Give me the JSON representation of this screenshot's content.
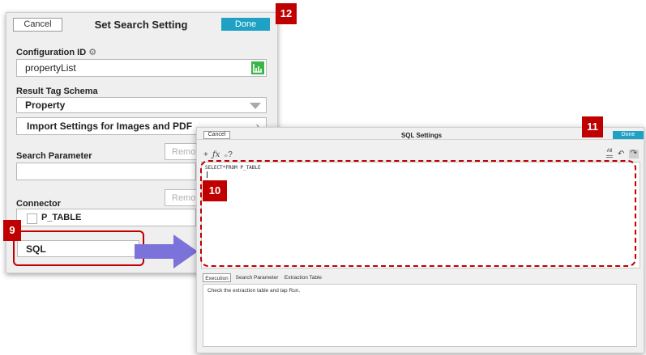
{
  "search_setting": {
    "cancel_label": "Cancel",
    "title": "Set Search Setting",
    "done_label": "Done",
    "configuration_id_label": "Configuration ID",
    "configuration_id_value": "propertyList",
    "result_tag_schema_label": "Result Tag Schema",
    "result_tag_schema_value": "Property",
    "import_settings_label": "Import Settings for Images and PDF",
    "search_parameter_label": "Search Parameter",
    "remove_label": "Remo",
    "connector_label": "Connector",
    "connector_item": "P_TABLE",
    "sql_label": "SQL"
  },
  "sql_settings": {
    "cancel_label": "Cancel",
    "title": "SQL Settings",
    "done_label": "Done",
    "toolbar_all_label": "All",
    "query": "SELECT*FROM P_TABLE",
    "tabs": [
      "Execution",
      "Search Parameter",
      "Extraction Table"
    ],
    "output_message": "Check the extraction table and tap Run."
  },
  "badges": {
    "b9": "9",
    "b10": "10",
    "b11": "11",
    "b12": "12"
  },
  "colors": {
    "accent_done": "#1ea1c4",
    "callout_red": "#c00000",
    "arrow_purple": "#7b73d9",
    "connector_green": "#3bb54a"
  }
}
